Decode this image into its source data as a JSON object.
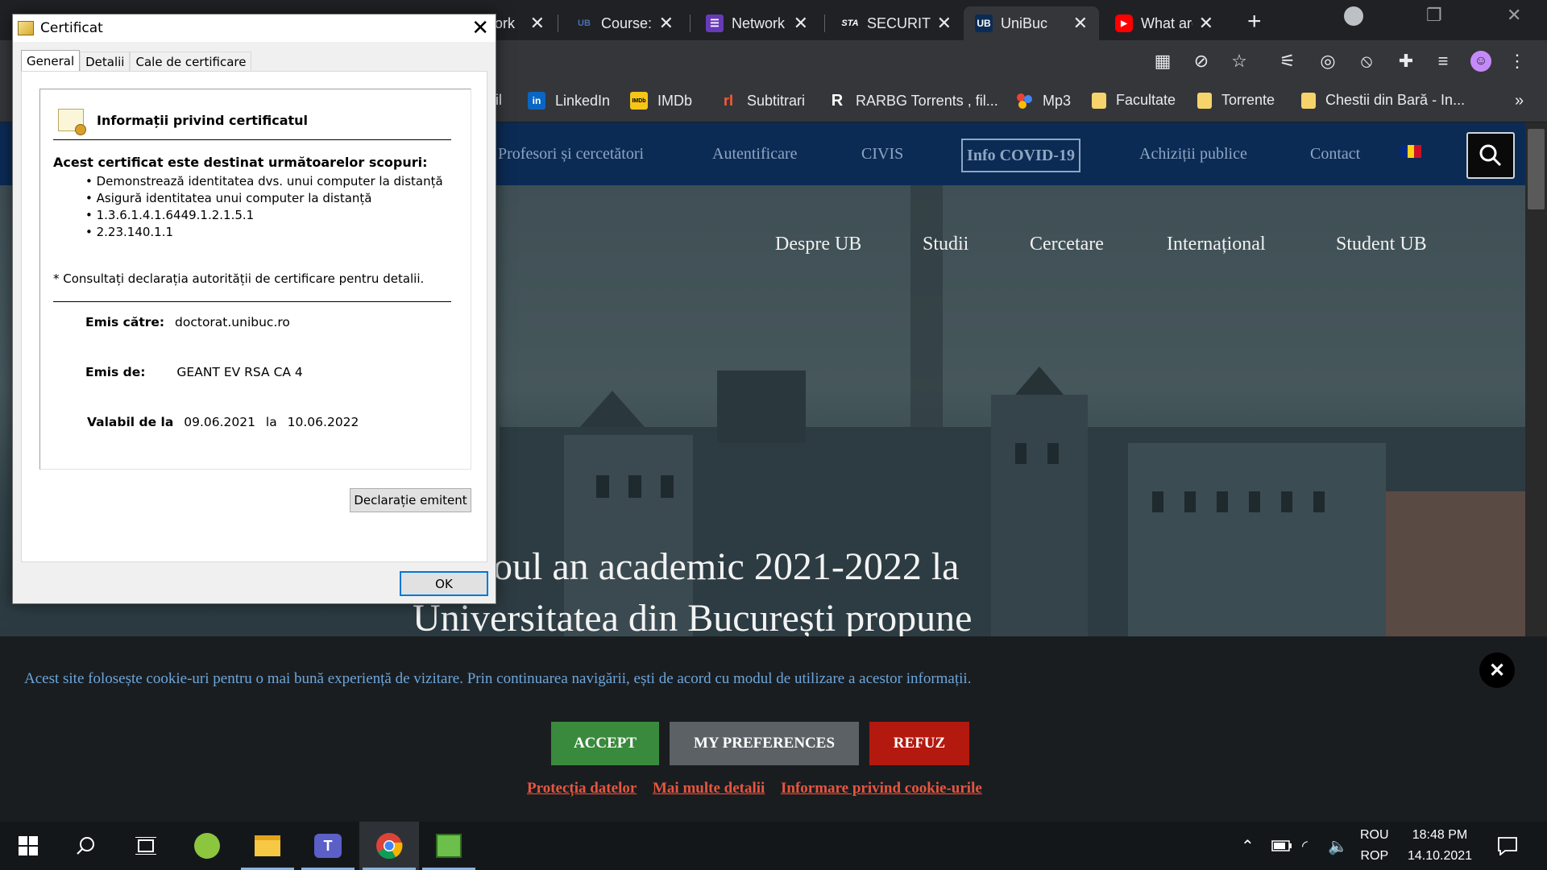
{
  "browser": {
    "tabs": [
      {
        "title": "ork",
        "favicon": "generic"
      },
      {
        "title": "Course: N",
        "favicon": "UB"
      },
      {
        "title": "Network",
        "favicon": "form-icon"
      },
      {
        "title": "SECURITY",
        "favicon": "STA"
      },
      {
        "title": "UniBuc",
        "favicon": "UB",
        "active": true
      },
      {
        "title": "What are",
        "favicon": "youtube-icon"
      }
    ],
    "bookmarks": [
      {
        "label": "il",
        "icon": "mail"
      },
      {
        "label": "LinkedIn",
        "icon": "in"
      },
      {
        "label": "IMDb",
        "icon": "IMDb"
      },
      {
        "label": "Subtitrari",
        "icon": "rl"
      },
      {
        "label": "RARBG Torrents , fil...",
        "icon": "R"
      },
      {
        "label": "Mp3",
        "icon": "dots"
      },
      {
        "label": "Facultate",
        "icon": "folder"
      },
      {
        "label": "Torrente",
        "icon": "folder"
      },
      {
        "label": "Chestii din Bară - In...",
        "icon": "folder"
      }
    ],
    "overflow": "»"
  },
  "site": {
    "nav": [
      "Profesori și cercetători",
      "Autentificare",
      "CIVIS",
      "Info COVID-19",
      "Achiziții publice",
      "Contact"
    ],
    "hero_menu": [
      "Despre UB",
      "Studii",
      "Cercetare",
      "Internațional",
      "Student UB"
    ],
    "hero_title_line1": "oul an academic 2021-2022 la",
    "hero_title_line2": "Universitatea din București propune"
  },
  "cookie": {
    "text": "Acest site folosește cookie-uri pentru o mai bună experiență de vizitare. Prin continuarea navigării, ești de acord cu modul de utilizare a acestor informații.",
    "accept": "ACCEPT",
    "prefs": "MY PREFERENCES",
    "refuse": "REFUZ",
    "links": [
      "Protecția datelor",
      "Mai multe detalii",
      "Informare privind cookie-urile"
    ],
    "colors": {
      "accept": "#3a8a3d",
      "prefs": "#5b6165",
      "refuse": "#b3190f",
      "link": "#e8553f",
      "text": "#6ba6dc"
    }
  },
  "dialog": {
    "title": "Certificat",
    "tabs": [
      "General",
      "Detalii",
      "Cale de certificare"
    ],
    "heading": "Informații privind certificatul",
    "purpose_heading": "Acest certificat este destinat următoarelor scopuri:",
    "purposes": [
      "• Demonstrează identitatea dvs. unui computer la distanță",
      "• Asigură identitatea unui computer la distanță",
      "• 1.3.6.1.4.1.6449.1.2.1.5.1",
      "• 2.23.140.1.1"
    ],
    "note": "* Consultați declarația autorității de certificare pentru detalii.",
    "issued_to_label": "Emis către:",
    "issued_to": "doctorat.unibuc.ro",
    "issued_by_label": "Emis de:",
    "issued_by": "GEANT EV RSA CA 4",
    "valid_label": "Valabil de la",
    "valid_from": "09.06.2021",
    "valid_to_label": "la",
    "valid_to": "10.06.2022",
    "issuer_statement": "Declarație emitent",
    "ok": "OK"
  },
  "taskbar": {
    "lang_top": "ROU",
    "lang_bottom": "ROP",
    "time": "18:48 PM",
    "date": "14.10.2021"
  }
}
